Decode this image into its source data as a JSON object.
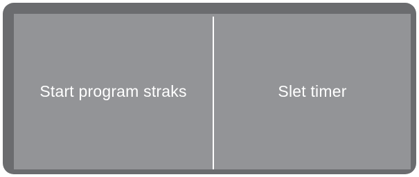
{
  "screen": {
    "options": [
      {
        "label": "Start program straks"
      },
      {
        "label": "Slet timer"
      }
    ]
  }
}
